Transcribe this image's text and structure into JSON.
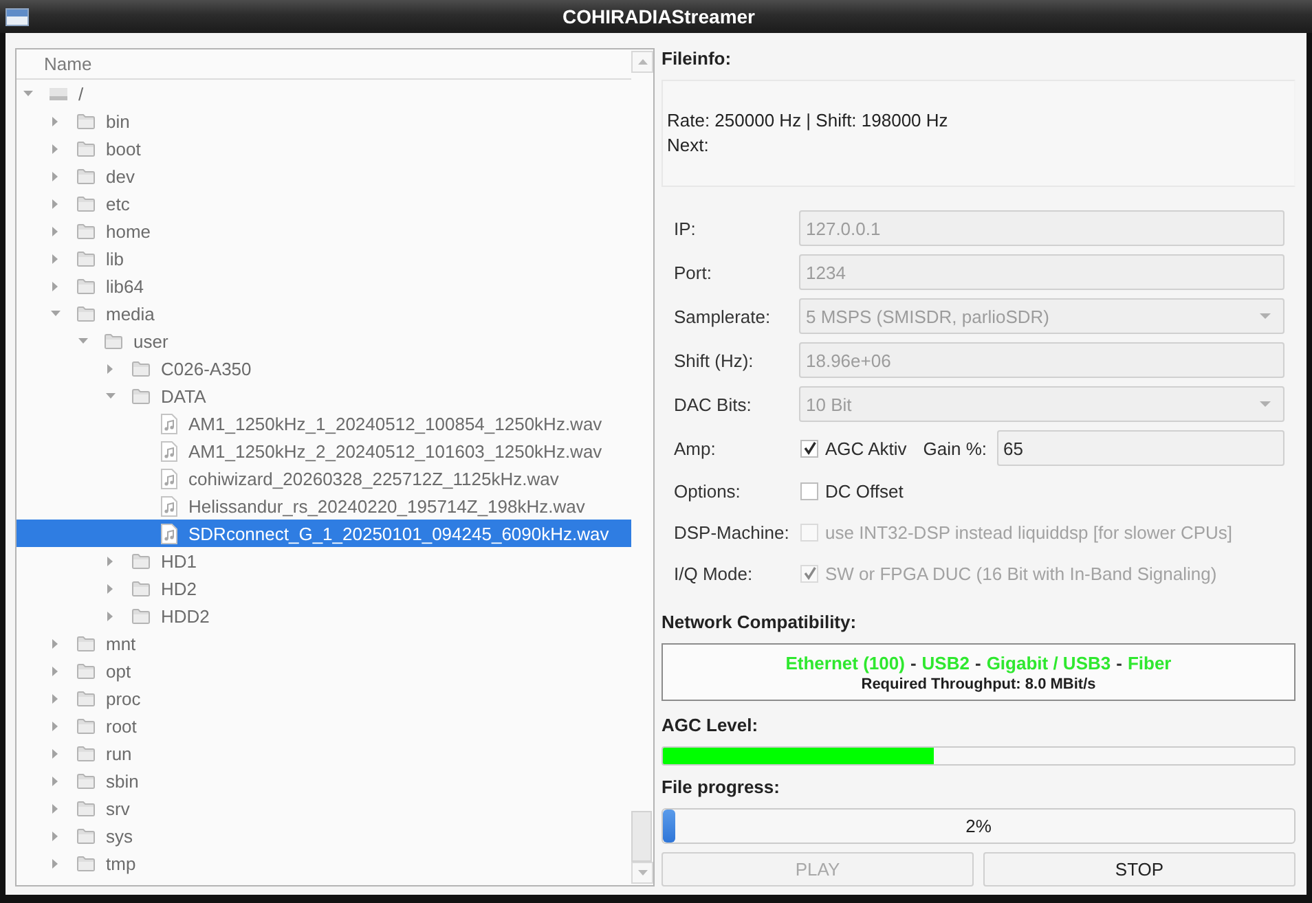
{
  "window": {
    "title": "COHIRADIAStreamer"
  },
  "tree": {
    "header": "Name",
    "items": [
      {
        "kind": "drive",
        "label": "/",
        "expanded": true,
        "selected": false,
        "children": [
          {
            "kind": "folder",
            "label": "bin",
            "expanded": false,
            "selected": false
          },
          {
            "kind": "folder",
            "label": "boot",
            "expanded": false,
            "selected": false
          },
          {
            "kind": "folder",
            "label": "dev",
            "expanded": false,
            "selected": false
          },
          {
            "kind": "folder",
            "label": "etc",
            "expanded": false,
            "selected": false
          },
          {
            "kind": "folder",
            "label": "home",
            "expanded": false,
            "selected": false
          },
          {
            "kind": "folder",
            "label": "lib",
            "expanded": false,
            "selected": false
          },
          {
            "kind": "folder",
            "label": "lib64",
            "expanded": false,
            "selected": false
          },
          {
            "kind": "folder",
            "label": "media",
            "expanded": true,
            "selected": false,
            "children": [
              {
                "kind": "folder",
                "label": "user",
                "expanded": true,
                "selected": false,
                "children": [
                  {
                    "kind": "folder",
                    "label": "C026-A350",
                    "expanded": false,
                    "selected": false
                  },
                  {
                    "kind": "folder",
                    "label": "DATA",
                    "expanded": true,
                    "selected": false,
                    "children": [
                      {
                        "kind": "file",
                        "label": "AM1_1250kHz_1_20240512_100854_1250kHz.wav",
                        "selected": false
                      },
                      {
                        "kind": "file",
                        "label": "AM1_1250kHz_2_20240512_101603_1250kHz.wav",
                        "selected": false
                      },
                      {
                        "kind": "file",
                        "label": "cohiwizard_20260328_225712Z_1125kHz.wav",
                        "selected": false
                      },
                      {
                        "kind": "file",
                        "label": "Helissandur_rs_20240220_195714Z_198kHz.wav",
                        "selected": false
                      },
                      {
                        "kind": "file",
                        "label": "SDRconnect_G_1_20250101_094245_6090kHz.wav",
                        "selected": true
                      }
                    ]
                  },
                  {
                    "kind": "folder",
                    "label": "HD1",
                    "expanded": false,
                    "selected": false
                  },
                  {
                    "kind": "folder",
                    "label": "HD2",
                    "expanded": false,
                    "selected": false
                  },
                  {
                    "kind": "folder",
                    "label": "HDD2",
                    "expanded": false,
                    "selected": false
                  }
                ]
              }
            ]
          },
          {
            "kind": "folder",
            "label": "mnt",
            "expanded": false,
            "selected": false
          },
          {
            "kind": "folder",
            "label": "opt",
            "expanded": false,
            "selected": false
          },
          {
            "kind": "folder",
            "label": "proc",
            "expanded": false,
            "selected": false
          },
          {
            "kind": "folder",
            "label": "root",
            "expanded": false,
            "selected": false
          },
          {
            "kind": "folder",
            "label": "run",
            "expanded": false,
            "selected": false
          },
          {
            "kind": "folder",
            "label": "sbin",
            "expanded": false,
            "selected": false
          },
          {
            "kind": "folder",
            "label": "srv",
            "expanded": false,
            "selected": false
          },
          {
            "kind": "folder",
            "label": "sys",
            "expanded": false,
            "selected": false
          },
          {
            "kind": "folder",
            "label": "tmp",
            "expanded": false,
            "selected": false
          }
        ]
      }
    ]
  },
  "fileinfo": {
    "title": "Fileinfo:",
    "lines": [
      "Rate: 250000 Hz | Shift: 198000 Hz",
      "Next:"
    ]
  },
  "settings": [
    {
      "kind": "text",
      "label": "IP:",
      "value": "127.0.0.1",
      "disabled": true
    },
    {
      "kind": "text",
      "label": "Port:",
      "value": "1234",
      "disabled": true
    },
    {
      "kind": "select",
      "label": "Samplerate:",
      "value": "5 MSPS (SMISDR, parlioSDR)",
      "disabled": true
    },
    {
      "kind": "text",
      "label": "Shift (Hz):",
      "value": "18.96e+06",
      "disabled": true
    },
    {
      "kind": "select",
      "label": "DAC Bits:",
      "value": "10 Bit",
      "disabled": true
    },
    {
      "kind": "amp",
      "label": "Amp:",
      "disabled": false,
      "agc": {
        "label": "AGC Aktiv",
        "checked": true
      },
      "gain_label": "Gain %:",
      "gain": "65"
    },
    {
      "kind": "check",
      "label": "Options:",
      "text": "DC Offset",
      "checked": false,
      "disabled": false
    },
    {
      "kind": "check",
      "label": "DSP-Machine:",
      "text": "use INT32-DSP instead liquiddsp [for slower CPUs]",
      "checked": false,
      "disabled": true
    },
    {
      "kind": "check",
      "label": "I/Q Mode:",
      "text": "SW or FPGA DUC (16 Bit with In-Band Signaling)",
      "checked": true,
      "disabled": true
    }
  ],
  "network": {
    "title": "Network Compatibility:",
    "interfaces": [
      {
        "label": "Ethernet (100)",
        "compatible": true
      },
      {
        "separator": "-",
        "label": "USB2",
        "compatible": true
      },
      {
        "separator": "-",
        "label": "Gigabit / USB3",
        "compatible": true
      },
      {
        "separator": "-",
        "label": "Fiber",
        "compatible": true
      }
    ],
    "throughput": "Required Throughput: 8.0 MBit/s"
  },
  "agc": {
    "title": "AGC Level:",
    "level": 0.43
  },
  "progress": {
    "title": "File progress:",
    "level": 0.02,
    "text": "2%"
  },
  "buttons": [
    {
      "label": "PLAY",
      "disabled": true
    },
    {
      "label": "STOP",
      "disabled": false
    }
  ]
}
